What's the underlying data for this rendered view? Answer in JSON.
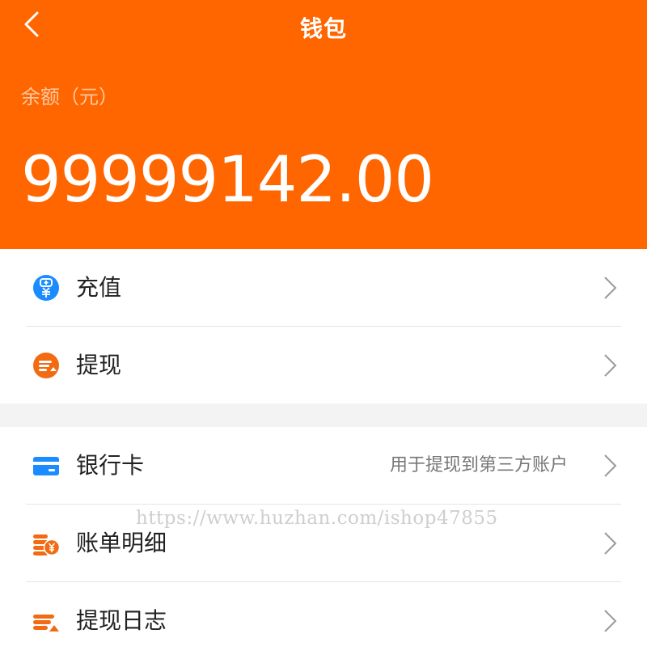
{
  "header": {
    "title": "钱包",
    "balance_label": "余额（元）",
    "balance_amount": "99999142.00",
    "background_color": "#ff6600"
  },
  "menu_group_1": [
    {
      "label": "充值",
      "icon": "recharge-icon",
      "icon_color": "#1a8cff"
    },
    {
      "label": "提现",
      "icon": "withdraw-icon",
      "icon_color": "#f26a12"
    }
  ],
  "menu_group_2": [
    {
      "label": "银行卡",
      "hint": "用于提现到第三方账户",
      "icon": "bank-card-icon",
      "icon_color": "#1a8cff"
    },
    {
      "label": "账单明细",
      "icon": "bill-details-icon",
      "icon_color": "#f26a12"
    },
    {
      "label": "提现日志",
      "icon": "withdraw-log-icon",
      "icon_color": "#f26a12"
    }
  ],
  "watermark": "https://www.huzhan.com/ishop47855"
}
